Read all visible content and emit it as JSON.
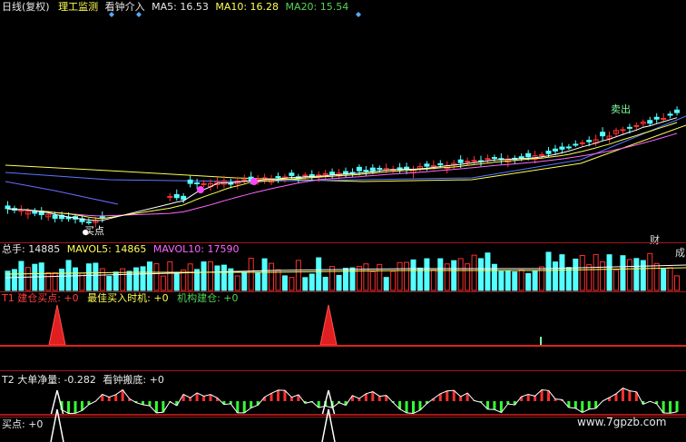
{
  "price_panel": {
    "period_label": "日线(复权)",
    "indicator_name": "理工监测",
    "indicator_tag": "看钟介入",
    "ma5_label": "MA5:",
    "ma5_value": "16.53",
    "ma10_label": "MA10:",
    "ma10_value": "16.28",
    "ma20_label": "MA20:",
    "ma20_value": "15.54",
    "buy_label": "买点",
    "sell_label": "卖出"
  },
  "volume_panel": {
    "total_label": "总手:",
    "total_value": "14885",
    "mavol5_label": "MAVOL5:",
    "mavol5_value": "14865",
    "mavol10_label": "MAVOL10:",
    "mavol10_value": "17590",
    "right_tab_top": "财",
    "right_tab_side": "成"
  },
  "t1_panel": {
    "label1": "T1 建仓买点:",
    "value1": "+0",
    "label2": "最佳买入时机:",
    "value2": "+0",
    "label3": "机构建仓:",
    "value3": "+0"
  },
  "t2_panel": {
    "label1": "T2 大单净量:",
    "value1": "-0.282",
    "label2": "看钟搬底:",
    "value2": "+0"
  },
  "buy_panel": {
    "label": "买点:",
    "value": "+0"
  },
  "watermark": "www.7gpzb.com",
  "colors": {
    "up": "#ff3030",
    "down": "#54ffff",
    "ma5": "#ffffff",
    "ma10": "#ffff55",
    "ma20": "#ff66ff",
    "separator": "#a01818"
  }
}
